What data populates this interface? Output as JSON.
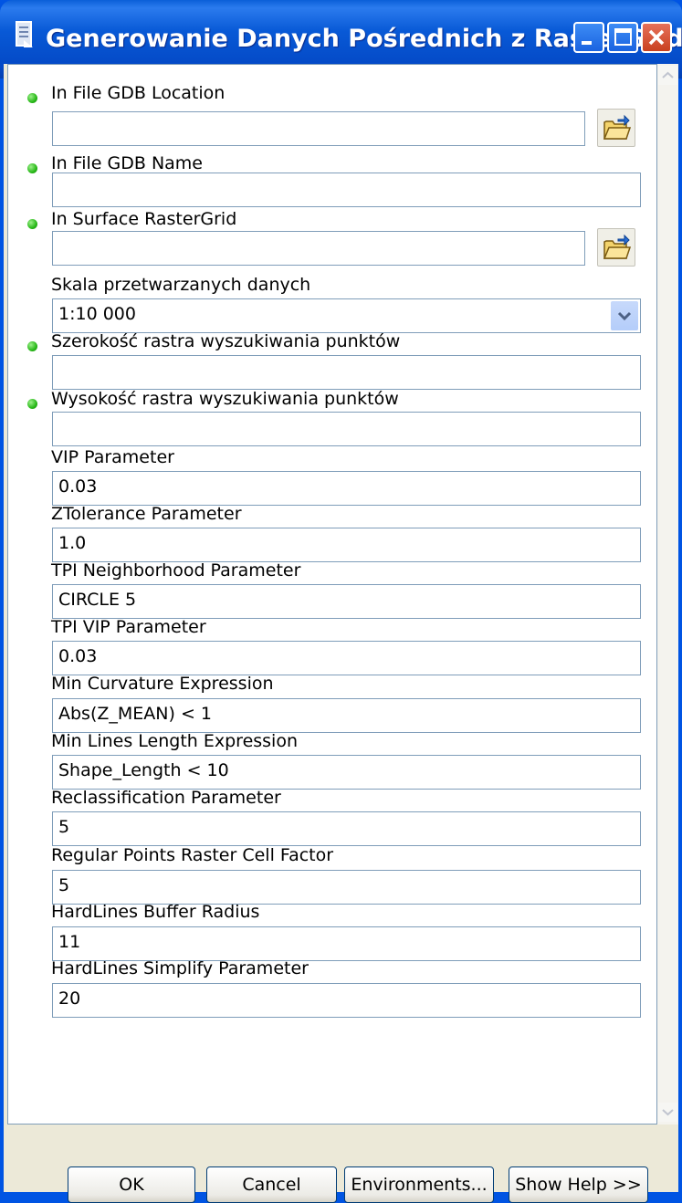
{
  "window": {
    "title": "Generowanie Danych Pośrednich z RasterGrid"
  },
  "params": [
    {
      "label": "In File GDB Location",
      "value": "",
      "required": true,
      "browse": true
    },
    {
      "label": "In File GDB Name",
      "value": "",
      "required": true,
      "browse": false
    },
    {
      "label": "In Surface RasterGrid",
      "value": "",
      "required": true,
      "browse": true
    },
    {
      "label": "Skala przetwarzanych danych",
      "value": "1:10 000",
      "required": false,
      "browse": false,
      "dropdown": true
    },
    {
      "label": "Szerokość rastra wyszukiwania punktów",
      "value": "",
      "required": true,
      "browse": false
    },
    {
      "label": "Wysokość rastra wyszukiwania punktów",
      "value": "",
      "required": true,
      "browse": false
    },
    {
      "label": "VIP Parameter",
      "value": "0.03",
      "required": false,
      "browse": false
    },
    {
      "label": "ZTolerance Parameter",
      "value": "1.0",
      "required": false,
      "browse": false
    },
    {
      "label": "TPI Neighborhood Parameter",
      "value": "CIRCLE 5",
      "required": false,
      "browse": false
    },
    {
      "label": "TPI VIP Parameter",
      "value": "0.03",
      "required": false,
      "browse": false
    },
    {
      "label": "Min Curvature Expression",
      "value": "Abs(Z_MEAN) < 1",
      "required": false,
      "browse": false
    },
    {
      "label": "Min Lines Length Expression",
      "value": "Shape_Length < 10",
      "required": false,
      "browse": false
    },
    {
      "label": "Reclassification Parameter",
      "value": "5",
      "required": false,
      "browse": false
    },
    {
      "label": "Regular Points Raster Cell Factor",
      "value": "5",
      "required": false,
      "browse": false
    },
    {
      "label": "HardLines Buffer Radius",
      "value": "11",
      "required": false,
      "browse": false
    },
    {
      "label": "HardLines Simplify Parameter",
      "value": "20",
      "required": false,
      "browse": false
    }
  ],
  "buttons": {
    "ok": "OK",
    "cancel": "Cancel",
    "environments": "Environments...",
    "show_help": "Show Help >>"
  },
  "icons": {
    "title": "toolbox-icon",
    "browse": "open-folder-icon",
    "required": "required-dot-icon",
    "dropdown": "chevron-down-icon"
  },
  "colors": {
    "titlebar": "#0054e3",
    "dialog_bg": "#ece9d8",
    "required_dot": "#28b818",
    "close_button": "#c9401f"
  }
}
